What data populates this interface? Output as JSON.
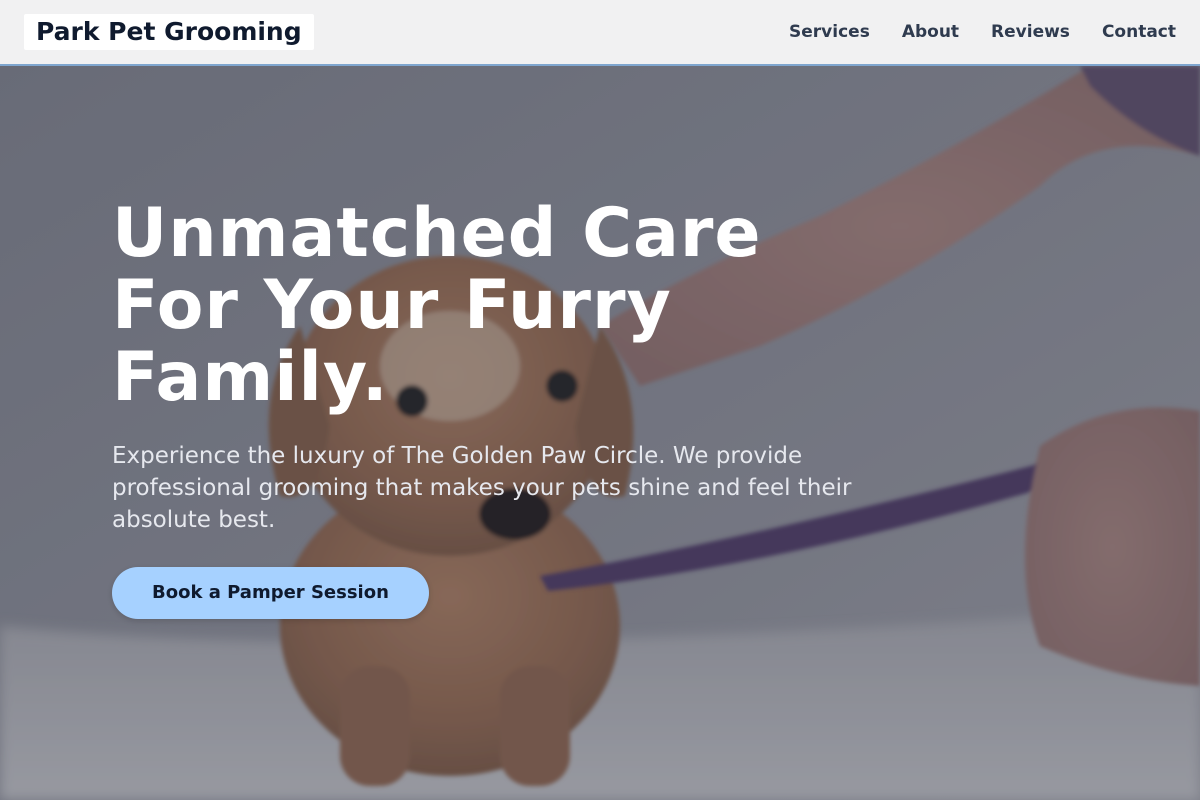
{
  "header": {
    "logo": "Park Pet Grooming",
    "nav": [
      {
        "label": "Services"
      },
      {
        "label": "About"
      },
      {
        "label": "Reviews"
      },
      {
        "label": "Contact"
      }
    ]
  },
  "hero": {
    "title_lines": [
      "Unmatched Care",
      "For Your Furry",
      "Family."
    ],
    "subtitle": "Experience the luxury of The Golden Paw Circle. We provide professional grooming that makes your pets shine and feel their absolute best.",
    "cta_label": "Book a Pamper Session"
  },
  "colors": {
    "header_bg": "#f1f1f2",
    "header_border": "#7fa6cf",
    "cta_bg": "#a6d1ff",
    "title_text": "#ffffff",
    "nav_text": "#2f3b4f"
  }
}
